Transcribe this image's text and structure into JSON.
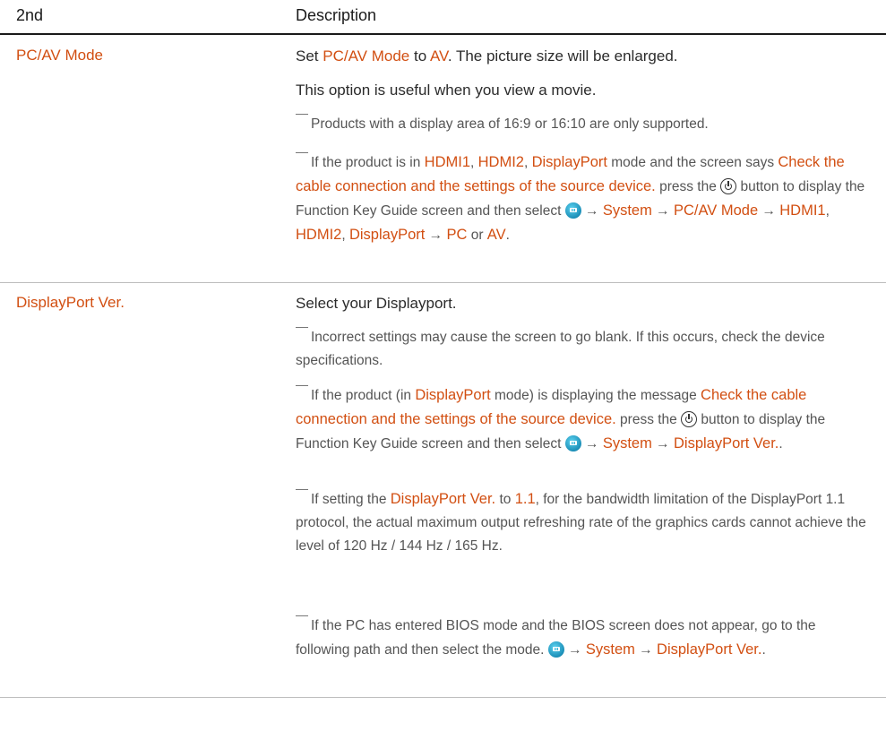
{
  "header": {
    "col1": "2nd",
    "col2": "Description"
  },
  "rows": [
    {
      "label": "PC/AV Mode",
      "intro": {
        "t1": "Set ",
        "h1": "PC/AV Mode",
        "t2": " to ",
        "h2": "AV",
        "t3": ". The picture size will be enlarged."
      },
      "p2": "This option is useful when you view a movie.",
      "note1": "Products with a display area of 16:9 or 16:10 are only supported.",
      "note2": {
        "t1": "If the product is in ",
        "h1": "HDMI1",
        "t2": ", ",
        "h2": "HDMI2",
        "t3": ", ",
        "h3": "DisplayPort",
        "t4": " mode and the screen says ",
        "h4": "Check the cable connection and the settings of the source device.",
        "t5": " press the ",
        "t6": " button to display the Function Key Guide screen and then select ",
        "arrow1": " → ",
        "h5": "System",
        "arrow2": " → ",
        "h6": "PC/AV Mode",
        "arrow3": " → ",
        "h7": "HDMI1",
        "t7": ", ",
        "h8": "HDMI2",
        "t8": ", ",
        "h9": "DisplayPort",
        "arrow4": " → ",
        "h10": "PC",
        "t9": " or ",
        "h11": "AV",
        "t10": "."
      }
    },
    {
      "label": "DisplayPort Ver.",
      "p1": "Select your Displayport.",
      "note1": "Incorrect settings may cause the screen to go blank. If this occurs, check the device specifications.",
      "note2": {
        "t1": "If the product (in ",
        "h1": "DisplayPort",
        "t2": " mode) is displaying the message ",
        "h2": "Check the cable connection and the settings of the source device.",
        "t3": " press the ",
        "t4": " button to display the Function Key Guide screen and then select ",
        "arrow1": " → ",
        "h3": "System",
        "arrow2": " → ",
        "h4": "DisplayPort Ver.",
        "t5": "."
      },
      "note3": {
        "t1": "If setting the ",
        "h1": "DisplayPort Ver.",
        "t2": " to ",
        "h2": "1.1",
        "t3": ", for the bandwidth limitation of the DisplayPort 1.1 protocol, the actual maximum output refreshing rate of the graphics cards cannot achieve the level of 120 Hz / 144 Hz / 165 Hz."
      },
      "note4": {
        "t1": "If the PC has entered BIOS mode and the BIOS screen does not appear, go to the following path and then select the mode. ",
        "arrow1": " → ",
        "h1": "System",
        "arrow2": " → ",
        "h2": "DisplayPort Ver.",
        "t2": "."
      }
    }
  ]
}
